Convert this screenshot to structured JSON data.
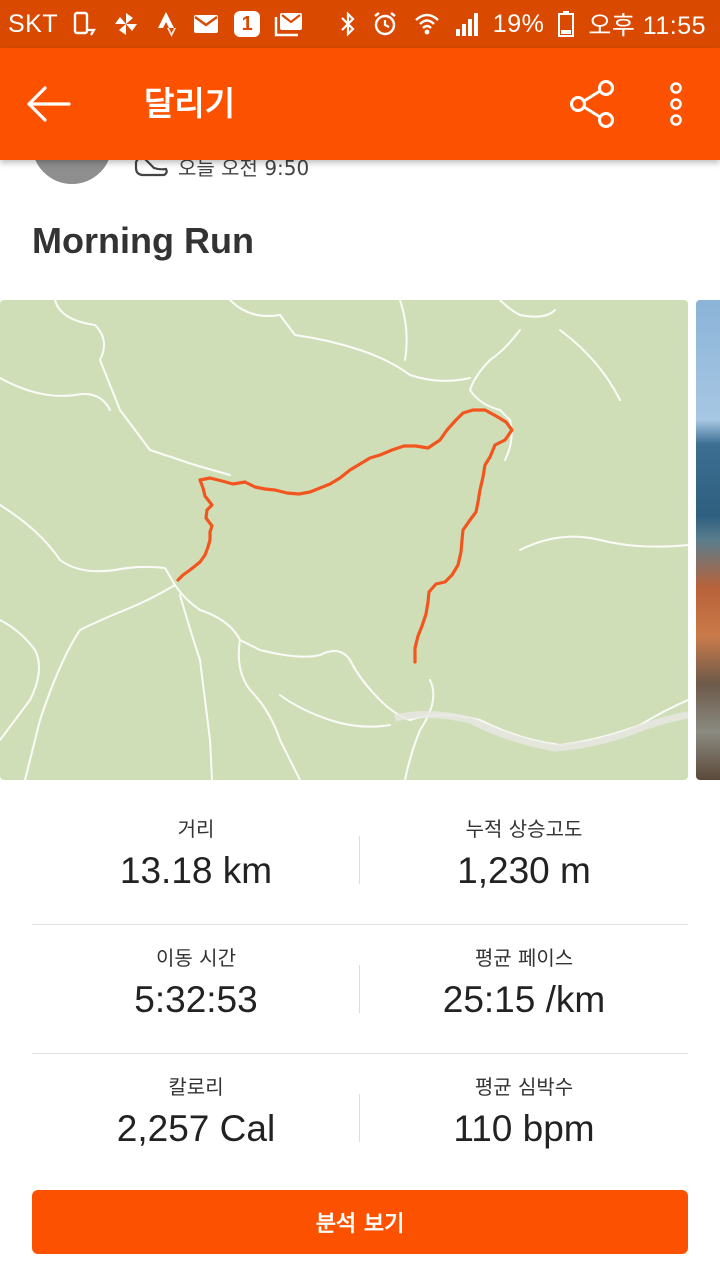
{
  "status_bar": {
    "carrier": "SKT",
    "notification_badge": "1",
    "battery": "19%",
    "time": "오후 11:55"
  },
  "app_bar": {
    "title": "달리기"
  },
  "activity": {
    "time": "오늘 오전 9:50",
    "title": "Morning Run"
  },
  "stats": [
    {
      "left": {
        "label": "거리",
        "value": "13.18 km"
      },
      "right": {
        "label": "누적 상승고도",
        "value": "1,230 m"
      }
    },
    {
      "left": {
        "label": "이동 시간",
        "value": "5:32:53"
      },
      "right": {
        "label": "평균 페이스",
        "value": "25:15 /km"
      }
    },
    {
      "left": {
        "label": "칼로리",
        "value": "2,257 Cal"
      },
      "right": {
        "label": "평균 심박수",
        "value": "110 bpm"
      }
    }
  ],
  "actions": {
    "analyze_label": "분석 보기"
  },
  "colors": {
    "brand": "#fc5200",
    "status_bar": "#d94a00",
    "map_bg": "#d0deb8",
    "route": "#f2551d"
  }
}
